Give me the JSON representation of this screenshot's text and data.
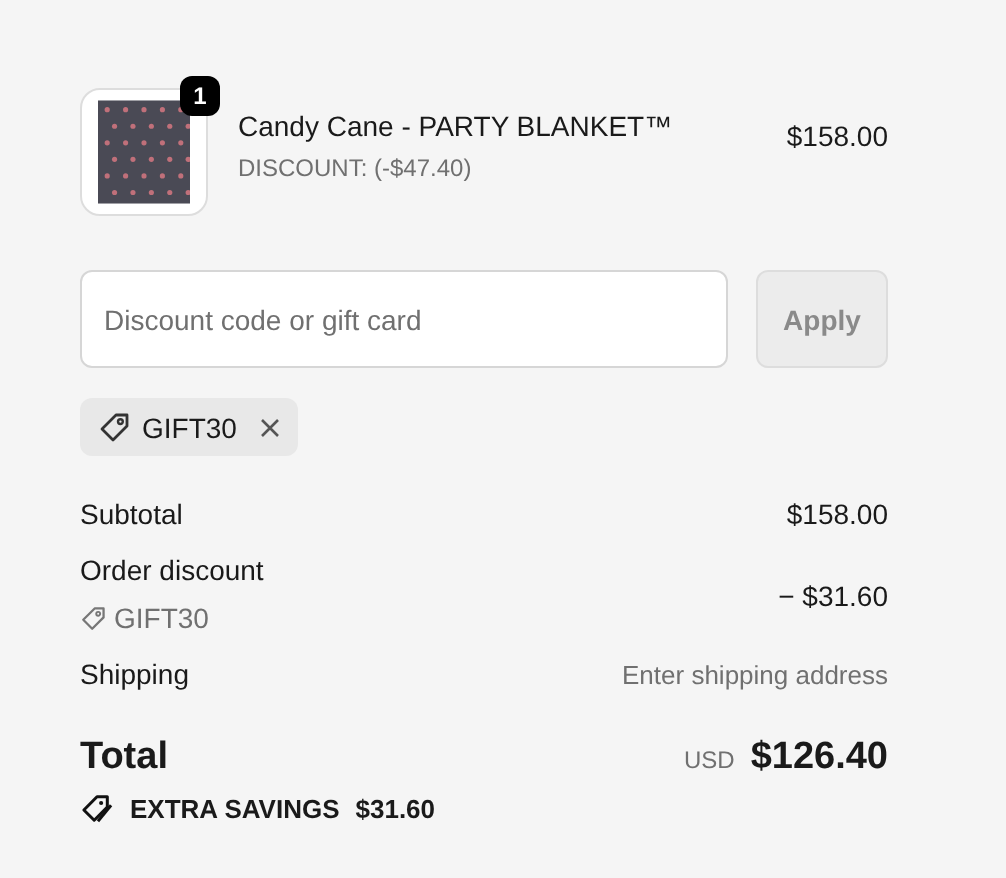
{
  "line_items": [
    {
      "quantity": "1",
      "name": "Candy Cane - PARTY BLANKET™",
      "discount": "DISCOUNT: (-$47.40)",
      "price": "$158.00"
    }
  ],
  "discount_field": {
    "placeholder": "Discount code or gift card",
    "button": "Apply",
    "button_disabled": true
  },
  "applied_codes": [
    {
      "code": "GIFT30"
    }
  ],
  "summary": [
    {
      "kind": "row",
      "label": "Subtotal",
      "value": "$158.00"
    },
    {
      "kind": "heading",
      "label": "Order discount"
    },
    {
      "kind": "code",
      "label": "GIFT30",
      "value": "− $31.60"
    },
    {
      "kind": "muted",
      "label": "Shipping",
      "value": "Enter shipping address"
    }
  ],
  "total": {
    "label": "Total",
    "currency": "USD",
    "value": "$126.40"
  },
  "savings": {
    "label": "EXTRA SAVINGS",
    "value": "$31.60"
  }
}
